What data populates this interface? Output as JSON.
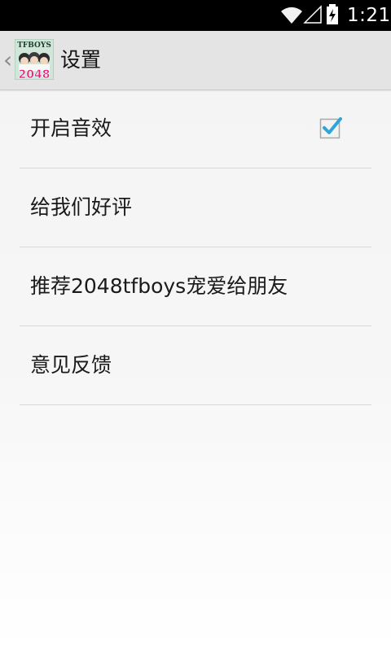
{
  "status_bar": {
    "time": "1:21",
    "icons": [
      "wifi-icon",
      "cell-signal-icon",
      "battery-charging-icon"
    ]
  },
  "action_bar": {
    "title": "设置",
    "up_icon": "chevron-left-icon",
    "app_icon": {
      "name": "tfboys-2048-app-icon",
      "top_text": "TFBOYS",
      "bottom_text": "2048"
    }
  },
  "settings": {
    "items": [
      {
        "label": "开启音效",
        "checked": true,
        "widget": "checkbox"
      },
      {
        "label": "给我们好评"
      },
      {
        "label": "推荐2048tfboys宠爱给朋友"
      },
      {
        "label": "意见反馈"
      }
    ]
  },
  "colors": {
    "check_accent": "#33b5e5",
    "action_bar_bg": "#e4e4e4",
    "divider": "#d8d8d8"
  }
}
